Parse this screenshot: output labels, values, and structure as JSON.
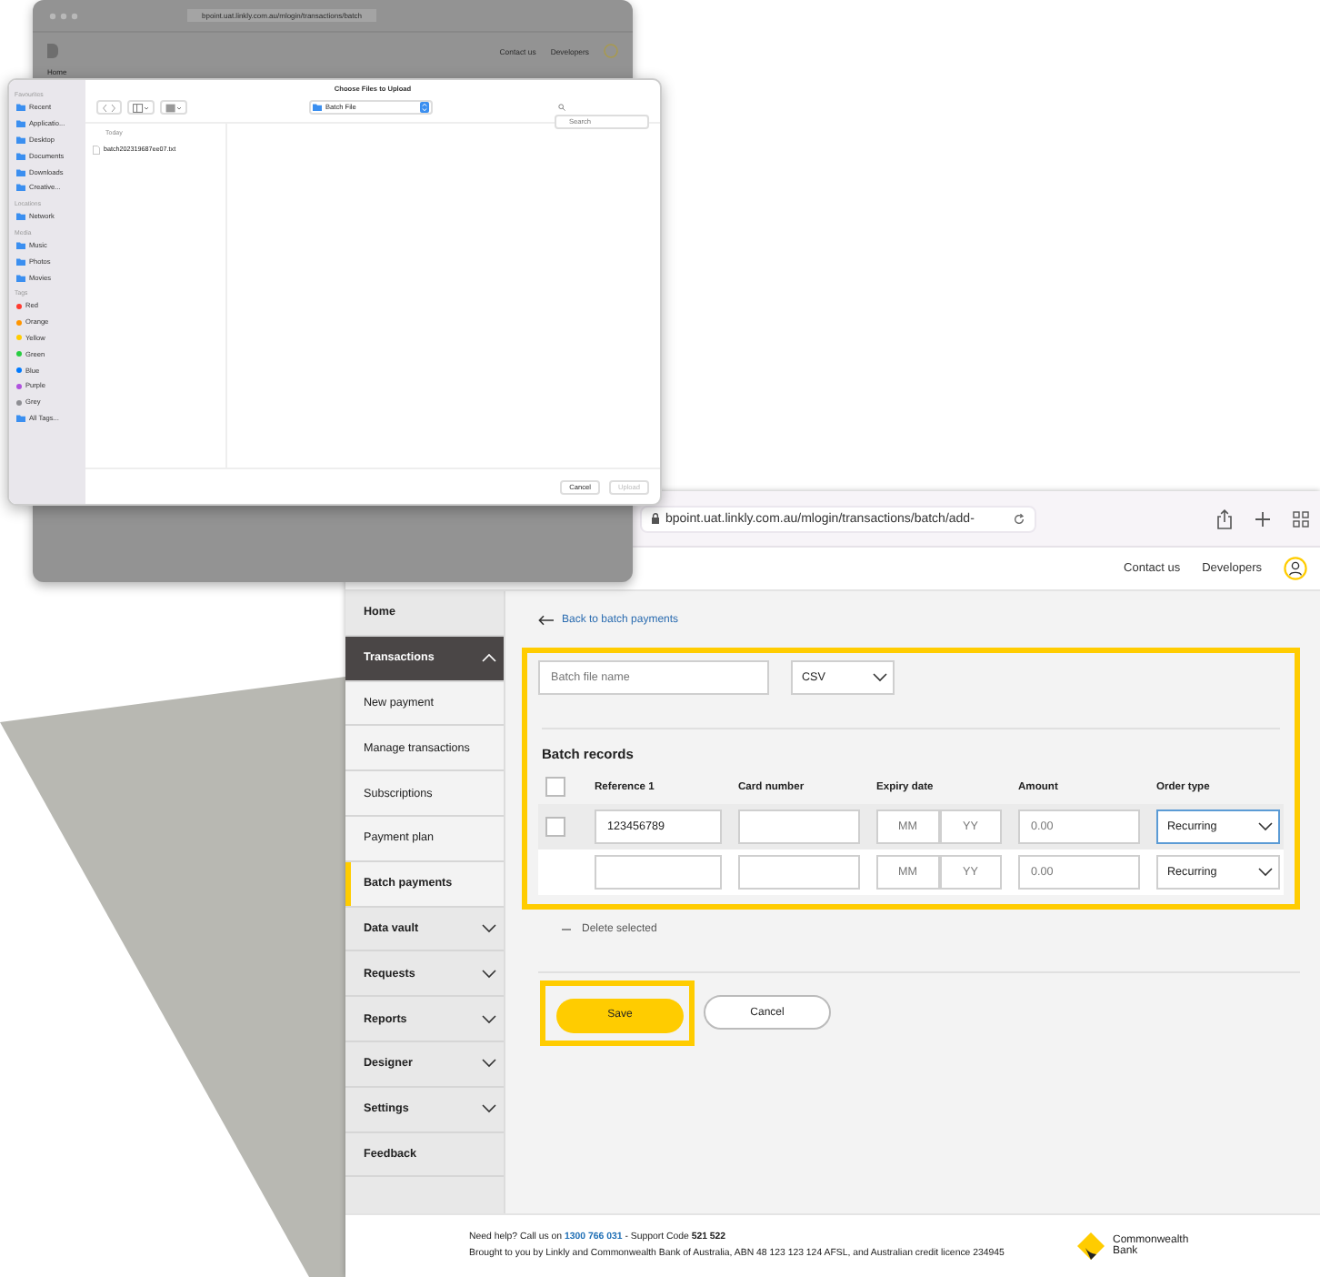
{
  "back_window": {
    "url": "bpoint.uat.linkly.com.au/mlogin/transactions/batch",
    "header_links": [
      "Contact us",
      "Developers"
    ],
    "nav_item": "Home"
  },
  "file_dialog": {
    "title": "Choose Files to Upload",
    "location": "Batch File",
    "search_placeholder": "Search",
    "column_heading": "Today",
    "files": [
      "batch202319687ee07.txt"
    ],
    "sidebar": [
      {
        "heading": "Favourites",
        "items": [
          {
            "label": "Recent",
            "kind": "place"
          },
          {
            "label": "Applicatio...",
            "kind": "place"
          },
          {
            "label": "Desktop",
            "kind": "place"
          },
          {
            "label": "Documents",
            "kind": "place"
          },
          {
            "label": "Downloads",
            "kind": "place"
          },
          {
            "label": "Creative...",
            "kind": "place"
          }
        ]
      },
      {
        "heading": "Locations",
        "items": [
          {
            "label": "Network",
            "kind": "place"
          }
        ]
      },
      {
        "heading": "Media",
        "items": [
          {
            "label": "Music",
            "kind": "place"
          },
          {
            "label": "Photos",
            "kind": "place"
          },
          {
            "label": "Movies",
            "kind": "place"
          }
        ]
      },
      {
        "heading": "Tags",
        "items": [
          {
            "label": "Red",
            "kind": "tag",
            "color": "#ff3b30"
          },
          {
            "label": "Orange",
            "kind": "tag",
            "color": "#ff9500"
          },
          {
            "label": "Yellow",
            "kind": "tag",
            "color": "#ffcc00"
          },
          {
            "label": "Green",
            "kind": "tag",
            "color": "#28cd41"
          },
          {
            "label": "Blue",
            "kind": "tag",
            "color": "#007aff"
          },
          {
            "label": "Purple",
            "kind": "tag",
            "color": "#af52de"
          },
          {
            "label": "Grey",
            "kind": "tag",
            "color": "#8e8e93"
          },
          {
            "label": "All Tags...",
            "kind": "place"
          }
        ]
      }
    ],
    "buttons": [
      {
        "label": "Cancel",
        "disabled": false
      },
      {
        "label": "Upload",
        "disabled": true
      }
    ]
  },
  "browser": {
    "url": "bpoint.uat.linkly.com.au/mlogin/transactions/batch/add-",
    "header_links": [
      "Contact us",
      "Developers"
    ],
    "sidebar": [
      {
        "label": "Home",
        "kind": "link",
        "selected": false
      },
      {
        "label": "Transactions",
        "kind": "group",
        "expanded": true,
        "selected": false
      },
      {
        "label": "New payment",
        "kind": "sub",
        "selected": false
      },
      {
        "label": "Manage transactions",
        "kind": "sub",
        "selected": false
      },
      {
        "label": "Subscriptions",
        "kind": "sub",
        "selected": false
      },
      {
        "label": "Payment plan",
        "kind": "sub",
        "selected": false
      },
      {
        "label": "Batch payments",
        "kind": "sub",
        "selected": true
      },
      {
        "label": "Data vault",
        "kind": "group",
        "expanded": false,
        "selected": false
      },
      {
        "label": "Requests",
        "kind": "group",
        "expanded": false,
        "selected": false
      },
      {
        "label": "Reports",
        "kind": "group",
        "expanded": false,
        "selected": false
      },
      {
        "label": "Designer",
        "kind": "group",
        "expanded": false,
        "selected": false
      },
      {
        "label": "Settings",
        "kind": "group",
        "expanded": false,
        "selected": false
      },
      {
        "label": "Feedback",
        "kind": "link",
        "selected": false
      }
    ],
    "back_link": "Back to batch payments",
    "form": {
      "highlighted": true,
      "batch_name_placeholder": "Batch file name",
      "format": "CSV",
      "section_title": "Batch records",
      "select_all": {
        "checked": false
      },
      "columns": [
        "Reference 1",
        "Card number",
        "Expiry date",
        "Amount",
        "Order type"
      ],
      "rows": [
        {
          "checkbox": {
            "checked": false
          },
          "hovered": true,
          "reference": "123456789",
          "month_placeholder": "MM",
          "year_placeholder": "YY",
          "amount_placeholder": "0.00",
          "order_type": "Recurring",
          "focused": true
        },
        {
          "hovered": false,
          "month_placeholder": "MM",
          "year_placeholder": "YY",
          "amount_placeholder": "0.00",
          "order_type": "Recurring",
          "focused": false
        }
      ]
    },
    "delete_label": "Delete selected",
    "buttons": [
      {
        "label": "Save",
        "kind": "primary",
        "highlighted": true
      },
      {
        "label": "Cancel",
        "kind": "secondary",
        "highlighted": false
      }
    ],
    "footer": {
      "help_prefix": "Need help? Call us on",
      "phone": "1300 766 031",
      "help_suffix": "- Support Code **521 522**",
      "brought_by": "Brought to you by Linkly and Commonwealth Bank of Australia, ABN 48 123 123 124 AFSL, and Australian credit licence 234945",
      "logo_text": "Commonwealth Bank"
    }
  }
}
